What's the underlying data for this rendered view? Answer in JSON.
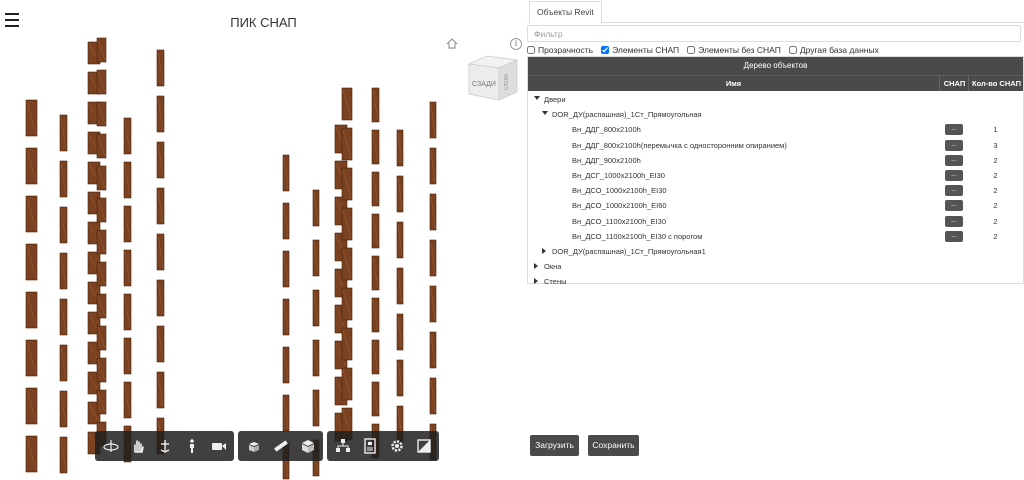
{
  "viewer": {
    "title": "ПИК СНАП",
    "viewcube_label": "СЗАДИ",
    "viewcube_side": "СЛЕВА"
  },
  "panel": {
    "tab_label": "Объекты Revit",
    "filter_placeholder": "Фильтр",
    "checkboxes": [
      {
        "label": "Прозрачность",
        "checked": false
      },
      {
        "label": "Элементы СНАП",
        "checked": true
      },
      {
        "label": "Элементы без СНАП",
        "checked": false
      },
      {
        "label": "Другая база данных",
        "checked": false
      }
    ],
    "tree": {
      "title": "Дерево объектов",
      "col_name": "Имя",
      "col_snap": "СНАП",
      "col_count": "Кол-во СНАП",
      "snap_button": "...",
      "rows": [
        {
          "label": "Двери",
          "level": 0,
          "expanded": true
        },
        {
          "label": "DOR_ДУ(распашная)_1Ст_Прямоугольная",
          "level": 1,
          "expanded": true
        },
        {
          "label": "Вн_ДДГ_800x2100h",
          "level": 2,
          "count": "1"
        },
        {
          "label": "Вн_ДДГ_800x2100h(перемычка с односторонним опиранием)",
          "level": 2,
          "count": "3"
        },
        {
          "label": "Вн_ДДГ_900x2100h",
          "level": 2,
          "count": "2"
        },
        {
          "label": "Вн_ДСГ_1000x2100h_EI30",
          "level": 2,
          "count": "2"
        },
        {
          "label": "Вн_ДСО_1000x2100h_EI30",
          "level": 2,
          "count": "2"
        },
        {
          "label": "Вн_ДСО_1000x2100h_EI60",
          "level": 2,
          "count": "2"
        },
        {
          "label": "Вн_ДСО_1100x2100h_EI30",
          "level": 2,
          "count": "2"
        },
        {
          "label": "Вн_ДСО_1100x2100h_EI30 с порогом",
          "level": 2,
          "count": "2"
        },
        {
          "label": "DOR_ДУ(распашная)_1Ст_Прямоугольная1",
          "level": 1,
          "expanded": false
        },
        {
          "label": "Окна",
          "level": 0,
          "expanded": false
        },
        {
          "label": "Стены",
          "level": 0,
          "expanded": false
        }
      ]
    },
    "buttons": {
      "load": "Загрузить",
      "save": "Сохранить"
    }
  },
  "toolbar": {
    "groups": [
      [
        "orbit-icon",
        "pan-icon",
        "zoom-icon",
        "first-person-icon",
        "camera-icon"
      ],
      [
        "explode-icon",
        "measure-icon",
        "section-icon"
      ],
      [
        "model-browser-icon",
        "properties-icon",
        "settings-icon",
        "fullscreen-icon"
      ]
    ]
  },
  "colors": {
    "door_brown": "#7a4220",
    "header_bg": "#4a4a4a",
    "button_bg": "#4a4a4a"
  }
}
